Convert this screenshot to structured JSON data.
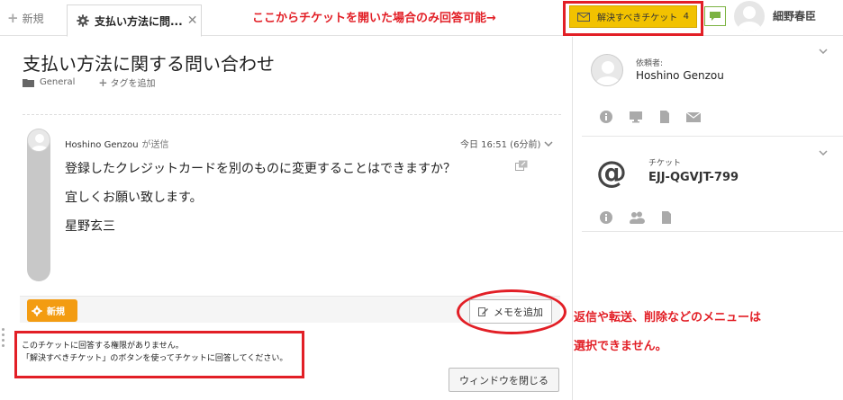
{
  "tabs": {
    "new_label": "新規",
    "active_label": "支払い方法に問..."
  },
  "header": {
    "callout": "ここからチケットを開いた場合のみ回答可能→",
    "solve_button_label": "解決すべきチケット",
    "solve_count": "4",
    "user_name": "細野春臣"
  },
  "ticket": {
    "title": "支払い方法に関する問い合わせ",
    "group": "General",
    "add_tag_label": "タグを追加"
  },
  "message": {
    "sender": "Hoshino Genzou",
    "sent_label": "が送信",
    "timestamp": "今日 16:51 (6分前)",
    "lines": [
      "登録したクレジットカードを別のものに変更することはできますか？",
      "宜しくお願い致します。",
      "星野玄三"
    ]
  },
  "footer": {
    "status_badge": "新規",
    "memo_button": "メモを追加",
    "permission_lines": [
      "このチケットに回答する権限がありません。",
      "「解決すべきチケット」のボタンを使ってチケットに回答してください。"
    ],
    "close_window": "ウィンドウを閉じる",
    "callout_lines": [
      "返信や転送、削除などのメニューは",
      "選択できません。"
    ]
  },
  "sidebar": {
    "requester_label": "依頼者:",
    "requester_name": "Hoshino Genzou",
    "ticket_label": "チケット",
    "ticket_id": "EJJ-QGVJT-799"
  },
  "colors": {
    "accent_red": "#e21f26",
    "solve_yellow": "#f2c200",
    "badge_orange": "#f39c12",
    "chat_green": "#7cb342"
  }
}
